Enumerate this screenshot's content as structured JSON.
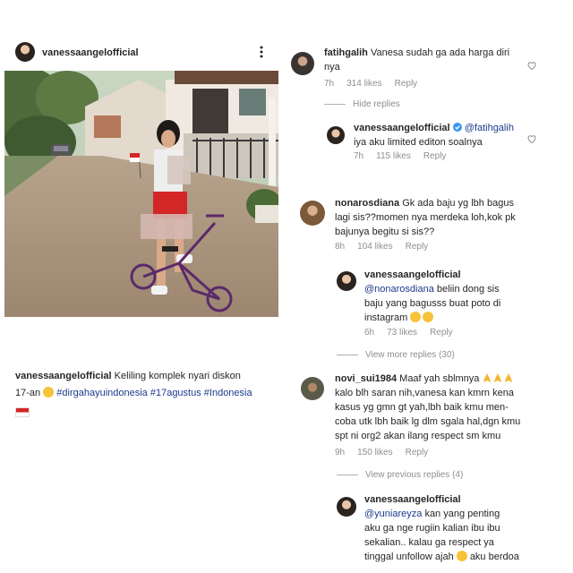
{
  "post": {
    "username": "vanessaangelofficial",
    "caption_user": "vanessaangelofficial",
    "caption_text": "Keliling komplek nyari diskon",
    "caption_line2": "17-an",
    "hashtags": "#dirgahayuindonesia #17agustus #Indonesia"
  },
  "comments": [
    {
      "user": "fatihgalih",
      "text1": "Vanesa sudah ga ada harga diri",
      "text2": "nya",
      "time": "7h",
      "likes": "314 likes",
      "reply": "Reply"
    },
    {
      "hide": "Hide replies"
    },
    {
      "user": "vanessaangelofficial",
      "mention": "@fatihgalih",
      "text1": "iya aku limited editon soalnya",
      "time": "7h",
      "likes": "115 likes",
      "reply": "Reply"
    },
    {
      "user": "nonarosdiana",
      "text1": "Gk ada baju yg lbh bagus",
      "text2": "lagi sis??momen nya merdeka loh,kok pk",
      "text3": "bajunya begitu si sis??",
      "time": "8h",
      "likes": "104 likes",
      "reply": "Reply"
    },
    {
      "user": "vanessaangelofficial",
      "mention": "@nonarosdiana",
      "text1": "beliin dong sis",
      "text2": "baju yang bagusss buat poto di",
      "text3": "instagram",
      "time": "6h",
      "likes": "73 likes",
      "reply": "Reply"
    },
    {
      "view": "View more replies (30)"
    },
    {
      "user": "novi_sui1984",
      "text1": "Maaf yah sblmnya",
      "text2": "kalo blh saran nih,vanesa kan kmrn kena",
      "text3": "kasus yg gmn gt yah,lbh baik kmu men-",
      "text4": "coba utk lbh baik lg dlm sgala hal,dgn kmu",
      "text5": "spt ni org2 akan ilang respect sm kmu",
      "time": "9h",
      "likes": "150 likes",
      "reply": "Reply"
    },
    {
      "view": "View previous replies (4)"
    },
    {
      "user": "vanessaangelofficial",
      "mention": "@yuniareyza",
      "text1": "kan yang penting",
      "text2": "aku ga nge rugiin kalian ibu ibu",
      "text3": "sekalian.. kalau ga respect ya",
      "text4": "tinggal unfollow ajah",
      "text5": "aku berdoa"
    }
  ],
  "colors": {
    "link": "#1b3a8c",
    "meta": "#8e8e8e",
    "verified": "#3897f0"
  }
}
